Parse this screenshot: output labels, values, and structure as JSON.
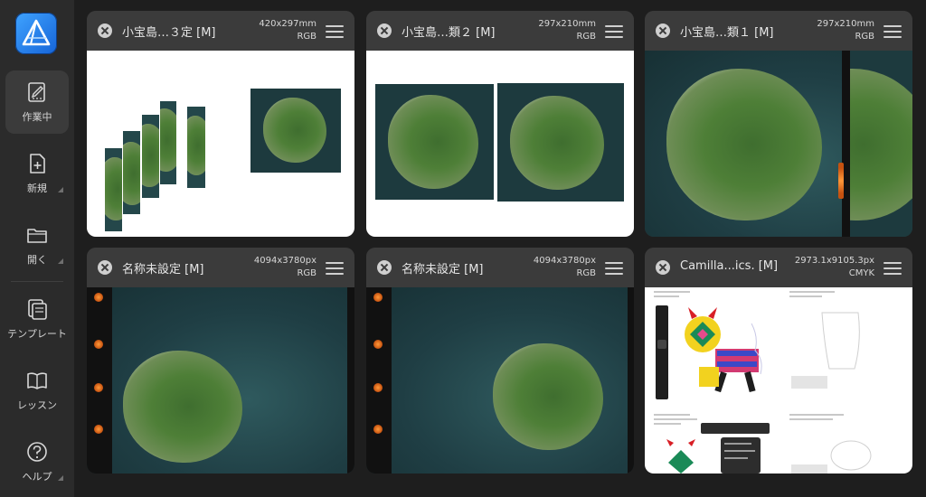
{
  "app": {
    "name": "Affinity Designer",
    "accent": "#2f86ef"
  },
  "sidebar": {
    "items": [
      {
        "label": "作業中",
        "icon": "document-edit-icon",
        "active": true
      },
      {
        "label": "新規",
        "icon": "new-document-icon",
        "active": false
      },
      {
        "label": "開く",
        "icon": "folder-icon",
        "active": false
      },
      {
        "label": "テンプレート",
        "icon": "template-icon",
        "active": false
      },
      {
        "label": "レッスン",
        "icon": "book-icon",
        "active": false
      },
      {
        "label": "ヘルプ",
        "icon": "question-icon",
        "active": false
      }
    ]
  },
  "documents": [
    {
      "title": "小宝島…３定 [M]",
      "size": "420x297mm",
      "mode": "RGB"
    },
    {
      "title": "小宝島…類２ [M]",
      "size": "297x210mm",
      "mode": "RGB"
    },
    {
      "title": "小宝島…類１ [M]",
      "size": "297x210mm",
      "mode": "RGB"
    },
    {
      "title": "名称未設定 [M]",
      "size": "4094x3780px",
      "mode": "RGB"
    },
    {
      "title": "名称未設定 [M]",
      "size": "4094x3780px",
      "mode": "RGB"
    },
    {
      "title": "Camilla...ics. [M]",
      "size": "2973.1x9105.3px",
      "mode": "CMYK"
    }
  ]
}
